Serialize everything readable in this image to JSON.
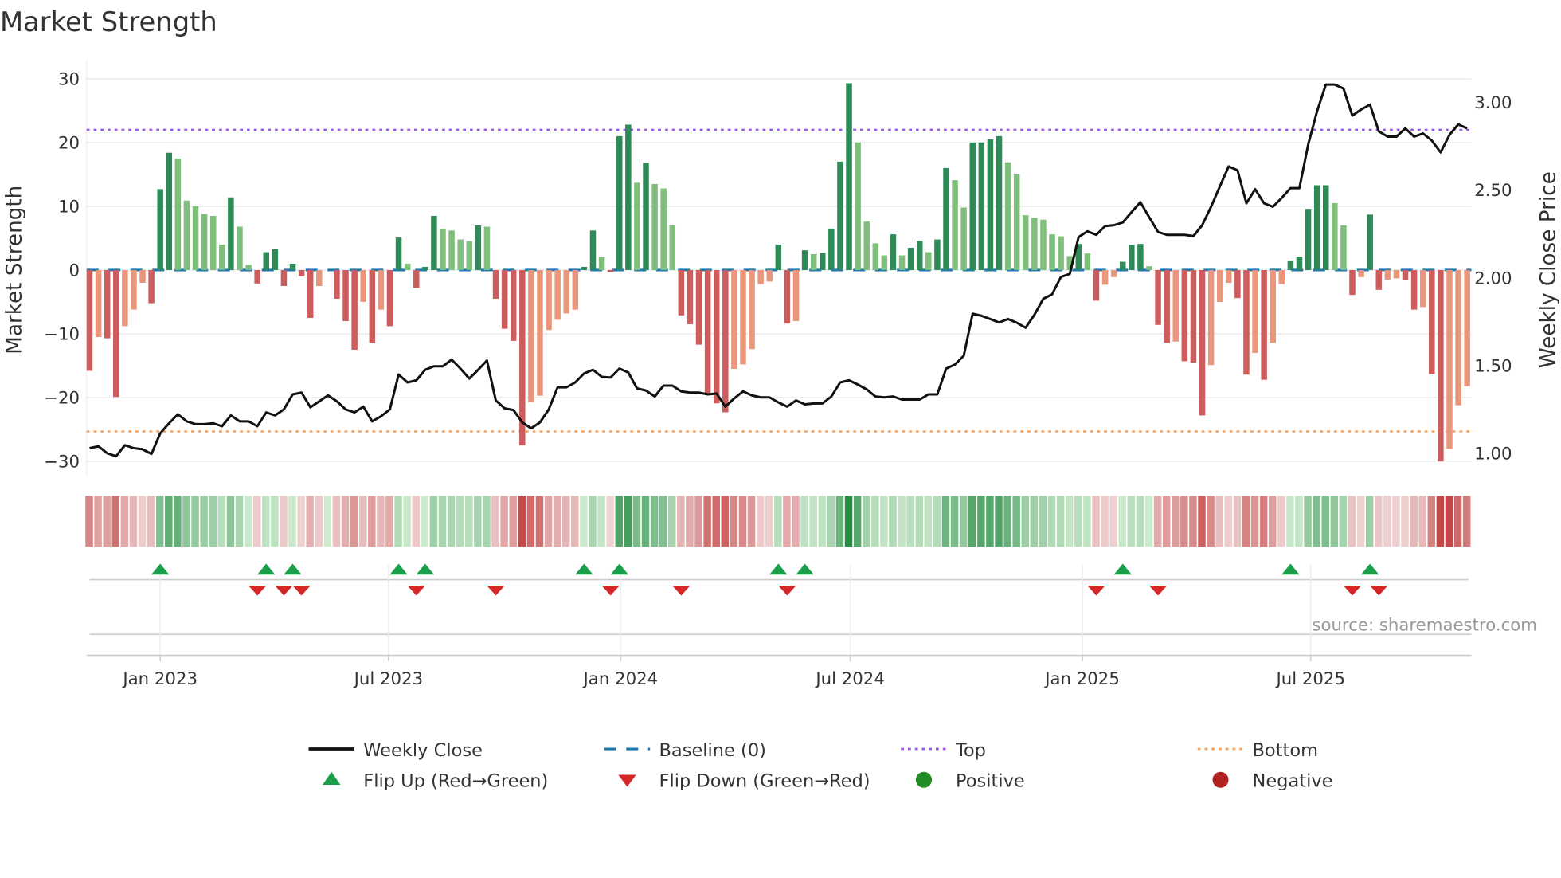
{
  "title": "Market Strength",
  "source": "source: sharemaestro.com",
  "chart_data": {
    "type": "bar",
    "title": "Market Strength",
    "start_date": "2022-11-06",
    "interval": "weekly",
    "ylabel": "Market Strength",
    "y2label": "Weekly Close Price",
    "ylim": [
      -32.3,
      32.2
    ],
    "y2lim": [
      0.864,
      3.21
    ],
    "yticks": [
      30,
      20,
      10,
      0,
      -10,
      -20,
      -30
    ],
    "ytick_labels": [
      "30",
      "20",
      "10",
      "0",
      "−10",
      "−20",
      "−30"
    ],
    "y2ticks": [
      3.0,
      2.5,
      2.0,
      1.5,
      1.0
    ],
    "y2tick_labels": [
      "3.00",
      "2.50",
      "2.00",
      "1.50",
      "1.00"
    ],
    "xticks": [
      "2023-01-01",
      "2023-07-01",
      "2024-01-01",
      "2024-07-01",
      "2025-01-01",
      "2025-07-01"
    ],
    "xtick_labels": [
      "Jan 2023",
      "Jul 2023",
      "Jan 2024",
      "Jul 2024",
      "Jan 2025",
      "Jul 2025"
    ],
    "top_level": 22,
    "bottom_level": -25.3,
    "baseline": 0,
    "grid": true,
    "strength": [
      -15.8,
      -10.5,
      -10.7,
      -19.9,
      -8.8,
      -6.2,
      -2,
      -5.2,
      12.7,
      18.4,
      17.5,
      10.9,
      10,
      8.8,
      8.5,
      4,
      11.4,
      6.8,
      0.8,
      -2.1,
      2.8,
      3.3,
      -2.5,
      1,
      -1,
      -7.5,
      -2.5,
      0,
      -4.5,
      -8,
      -12.5,
      -5,
      -11.4,
      -6.2,
      -8.8,
      5.1,
      1,
      -2.8,
      0.5,
      8.5,
      6.5,
      6.2,
      4.8,
      4.5,
      7,
      6.8,
      -4.5,
      -9.2,
      -11.1,
      -27.5,
      -20.7,
      -19.7,
      -9.4,
      -7.8,
      -6.8,
      -6.2,
      0.5,
      6.2,
      2,
      -0.3,
      21,
      22.8,
      13.7,
      16.8,
      13.5,
      12.8,
      7,
      -7.1,
      -8.5,
      -11.7,
      -19.3,
      -20.9,
      -22.3,
      -15.5,
      -14.8,
      -12.4,
      -2.2,
      -1.8,
      4,
      -8.4,
      -8,
      3.1,
      2.5,
      2.7,
      6.5,
      17,
      29.3,
      20,
      7.6,
      4.2,
      2.3,
      5.6,
      2.3,
      3.5,
      4.6,
      2.8,
      4.8,
      16,
      14.1,
      9.8,
      20,
      20,
      20.5,
      21,
      16.9,
      15,
      8.6,
      8.2,
      7.9,
      5.6,
      5.3,
      2.2,
      4.1,
      2.6,
      -4.8,
      -2.3,
      -1.1,
      1.3,
      4,
      4.1,
      0.6,
      -8.6,
      -11.4,
      -11.2,
      -14.3,
      -14.5,
      -22.8,
      -14.9,
      -5,
      -2,
      -4.4,
      -16.4,
      -13,
      -17.2,
      -11.4,
      -2.2,
      1.5,
      2.1,
      9.6,
      13.3,
      13.3,
      10.5,
      7,
      -3.9,
      -1.1,
      8.7,
      -3.1,
      -1.5,
      -1.3,
      -1.6,
      -6.2,
      -5.8,
      -16.3,
      -30,
      -28.1,
      -21.2,
      -18.2
    ],
    "weekly_close": [
      1.023,
      1.034,
      0.994,
      0.977,
      1.04,
      1.023,
      1.017,
      0.99,
      1.108,
      1.165,
      1.216,
      1.176,
      1.16,
      1.16,
      1.165,
      1.148,
      1.21,
      1.176,
      1.176,
      1.148,
      1.227,
      1.21,
      1.244,
      1.33,
      1.34,
      1.256,
      1.29,
      1.324,
      1.29,
      1.244,
      1.227,
      1.26,
      1.176,
      1.205,
      1.244,
      1.443,
      1.398,
      1.41,
      1.47,
      1.49,
      1.49,
      1.528,
      1.477,
      1.42,
      1.47,
      1.523,
      1.295,
      1.25,
      1.24,
      1.17,
      1.136,
      1.17,
      1.244,
      1.37,
      1.37,
      1.398,
      1.449,
      1.47,
      1.43,
      1.426,
      1.477,
      1.455,
      1.364,
      1.352,
      1.318,
      1.38,
      1.38,
      1.347,
      1.34,
      1.34,
      1.33,
      1.335,
      1.26,
      1.307,
      1.347,
      1.324,
      1.313,
      1.313,
      1.284,
      1.26,
      1.295,
      1.273,
      1.278,
      1.278,
      1.318,
      1.398,
      1.41,
      1.386,
      1.358,
      1.318,
      1.313,
      1.318,
      1.3,
      1.3,
      1.3,
      1.33,
      1.33,
      1.477,
      1.5,
      1.55,
      1.79,
      1.778,
      1.76,
      1.74,
      1.76,
      1.739,
      1.71,
      1.784,
      1.875,
      1.9,
      2.0,
      2.017,
      2.227,
      2.26,
      2.24,
      2.29,
      2.295,
      2.31,
      2.37,
      2.426,
      2.34,
      2.256,
      2.24,
      2.24,
      2.24,
      2.233,
      2.295,
      2.4,
      2.517,
      2.63,
      2.608,
      2.42,
      2.5,
      2.42,
      2.4,
      2.45,
      2.506,
      2.506,
      2.756,
      2.943,
      3.097,
      3.097,
      3.074,
      2.92,
      2.955,
      2.983,
      2.83,
      2.8,
      2.8,
      2.847,
      2.8,
      2.818,
      2.778,
      2.71,
      2.81,
      2.87,
      2.847
    ],
    "legend": {
      "placement": "bottom",
      "items": [
        {
          "key": "close",
          "label": "Weekly Close"
        },
        {
          "key": "baseline",
          "label": "Baseline (0)"
        },
        {
          "key": "top",
          "label": "Top"
        },
        {
          "key": "bottom",
          "label": "Bottom"
        },
        {
          "key": "flip_up",
          "label": "Flip Up (Red→Green)"
        },
        {
          "key": "flip_down",
          "label": "Flip Down (Green→Red)"
        },
        {
          "key": "positive",
          "label": "Positive"
        },
        {
          "key": "negative",
          "label": "Negative"
        }
      ]
    }
  },
  "colors": {
    "pos_strong": "#2e8b57",
    "pos_weak": "#7fbf7b",
    "neg_strong": "#cd5c5c",
    "neg_weak": "#e9967a",
    "baseline": "#1f77b4",
    "top": "#9b59e6",
    "bottom": "#f4a460",
    "close": "#111111",
    "flip_up": "#1a9e4a",
    "flip_down": "#d62728",
    "positive": "#228b22",
    "negative": "#b22222"
  }
}
